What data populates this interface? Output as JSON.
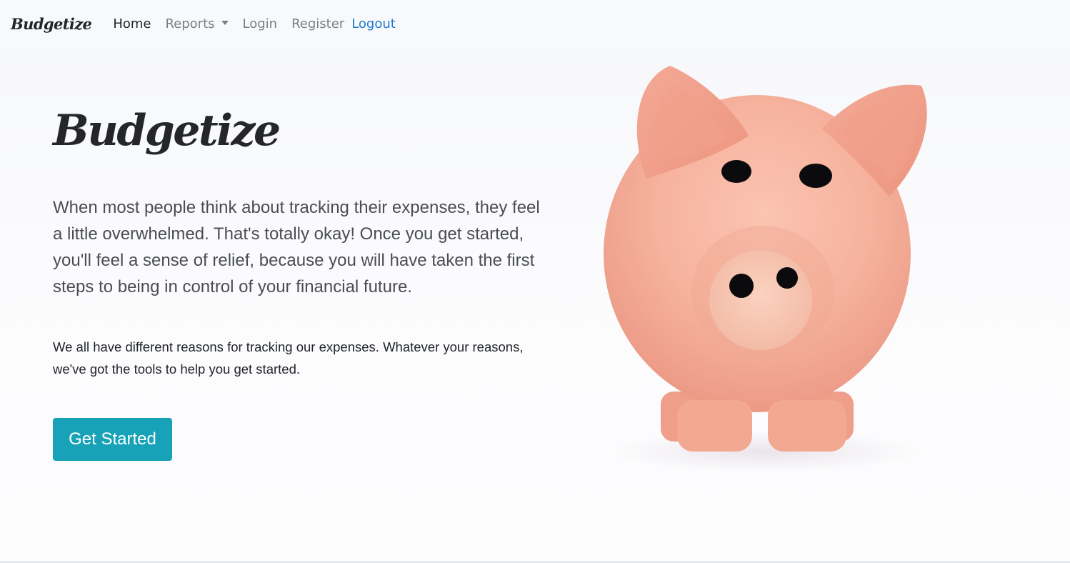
{
  "nav": {
    "brand": "Budgetize",
    "home": "Home",
    "reports": "Reports",
    "login": "Login",
    "register": "Register",
    "logout": "Logout"
  },
  "hero": {
    "title": "Budgetize",
    "lead": "When most people think about tracking their expenses, they feel a little overwhelmed. That's totally okay! Once you get started, you'll feel a sense of relief, because you will have taken the first steps to being in control of your financial future.",
    "sub": "We all have different reasons for tracking our expenses. Whatever your reasons, we've got the tools to help you get started.",
    "button": "Get Started"
  },
  "colors": {
    "accent": "#17a2b8",
    "link_blue": "#1f7bd0",
    "pig_pink": "#f6b39f"
  },
  "icons": {
    "reports_caret": "caret-down-icon",
    "hero_image": "piggy-bank-icon"
  }
}
